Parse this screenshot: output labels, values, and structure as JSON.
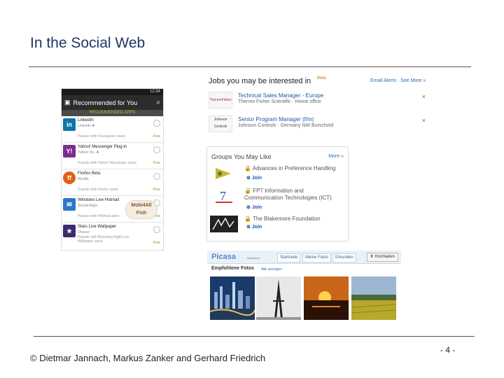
{
  "slide": {
    "title": "In the Social Web",
    "footer": "© Dietmar Jannach, Markus Zanker and Gerhard Friedrich",
    "page_number": "- 4 -"
  },
  "phone": {
    "status_time": "12:34",
    "header_title": "Recommended for You",
    "subheader": "RECOMMENDED APPS",
    "apps": [
      {
        "name": "LinkedIn",
        "publisher": "LinkedIn ✚",
        "popular": "Popular with Foursquare users",
        "popular2": "",
        "price": "Free",
        "icon_color": "#0e76a8",
        "icon_text": "in"
      },
      {
        "name": "Yahoo! Messenger Plug-in",
        "publisher": "Yahoo! Inc. ✚",
        "popular": "Popular with Yahoo! Messenger users",
        "popular2": "",
        "price": "Free",
        "icon_color": "#7b2c8f",
        "icon_text": "Y!"
      },
      {
        "name": "Firefox Beta",
        "publisher": "Mozilla",
        "popular": "Popular with Firefox users",
        "popular2": "",
        "price": "Free",
        "icon_color": "#e0601a",
        "icon_text": "ff"
      },
      {
        "name": "Windows Live Hotmail",
        "publisher": "SeesterApps",
        "popular": "Popular with Hotmail users",
        "popular2": "",
        "price": "Free",
        "icon_color": "#2b78c5",
        "icon_text": "✉"
      },
      {
        "name": "Stars Live Wallpaper",
        "publisher": "Dhuson",
        "popular": "Popular with Blooming Night Live",
        "popular2": "Wallpaper users",
        "price": "Free",
        "icon_color": "#3a2b6e",
        "icon_text": "★"
      }
    ],
    "badge": [
      "Mobi4All",
      "Fish"
    ]
  },
  "jobs": {
    "title": "Jobs you may be interested in",
    "beta": "Beta",
    "links": "Email Alerts · See More »",
    "items": [
      {
        "title": "Technical Sales Manager - Europe",
        "company": "Thermo Fisher Scientific · Home office",
        "logo": "ThermoFisher"
      },
      {
        "title": "Senior Program Manager (f/m)",
        "company": "Johnson Controls · Germany NW Burscheid",
        "logo": "Johnson Controls"
      }
    ]
  },
  "groups": {
    "title": "Groups You May Like",
    "more": "More »",
    "items": [
      {
        "name": "Advances in Preference Handling",
        "join": "Join"
      },
      {
        "name": "FP7 Information and Communication Technologies (ICT)",
        "join": "Join"
      },
      {
        "name": "The Blakemore Foundation",
        "join": "Join"
      }
    ]
  },
  "picasa": {
    "logo": "Picasa",
    "logo_sub": "Webalben",
    "tabs": [
      "Startseite",
      "Meine Fotos",
      "Erkunden"
    ],
    "upload": "⬆ Hochladen",
    "section": "Empfohlene Fotos",
    "show_all": "Alle anzeigen"
  }
}
